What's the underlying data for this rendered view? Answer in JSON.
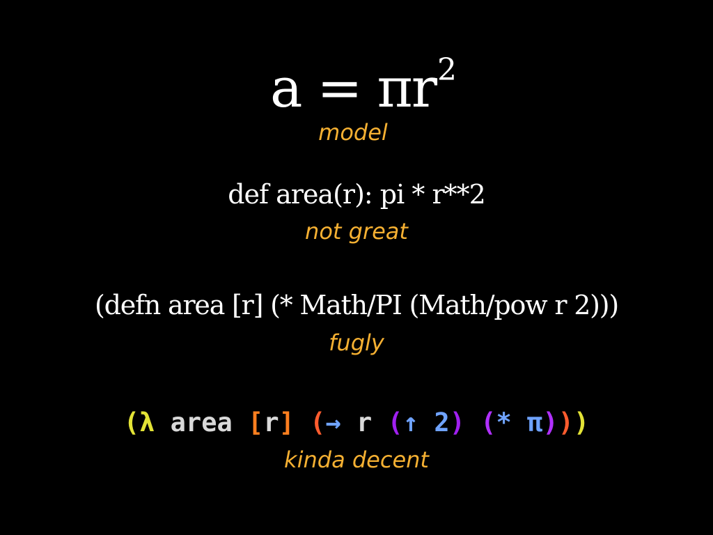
{
  "formula": {
    "main": "a = πr",
    "superscript": "2",
    "note": "model"
  },
  "python": {
    "code": "def area(r): pi * r**2",
    "note": "not great"
  },
  "clojure": {
    "code": "(defn area [r] (* Math/PI (Math/pow r 2)))",
    "note": "fugly"
  },
  "lambda": {
    "tokens": [
      {
        "text": "(λ",
        "color": "#e3e336"
      },
      {
        "text": " area ",
        "color": "#d9d9d9"
      },
      {
        "text": "[",
        "color": "#ff7f1f"
      },
      {
        "text": "r",
        "color": "#d9d9d9"
      },
      {
        "text": "]",
        "color": "#ff7f1f"
      },
      {
        "text": " (",
        "color": "#ff5c2e"
      },
      {
        "text": "→",
        "color": "#6fa3ff"
      },
      {
        "text": " r ",
        "color": "#d9d9d9"
      },
      {
        "text": "(",
        "color": "#a020f0"
      },
      {
        "text": "↑ 2",
        "color": "#6fa3ff"
      },
      {
        "text": ")",
        "color": "#a020f0"
      },
      {
        "text": " (",
        "color": "#b030ff"
      },
      {
        "text": "* π",
        "color": "#6fa3ff"
      },
      {
        "text": ")",
        "color": "#b030ff"
      },
      {
        "text": ")",
        "color": "#ff5c2e"
      },
      {
        "text": ")",
        "color": "#e3e336"
      }
    ],
    "note": "kinda decent"
  },
  "colors": {
    "background": "#000000",
    "code_text": "#ffffff",
    "annotation": "#f5b032"
  }
}
